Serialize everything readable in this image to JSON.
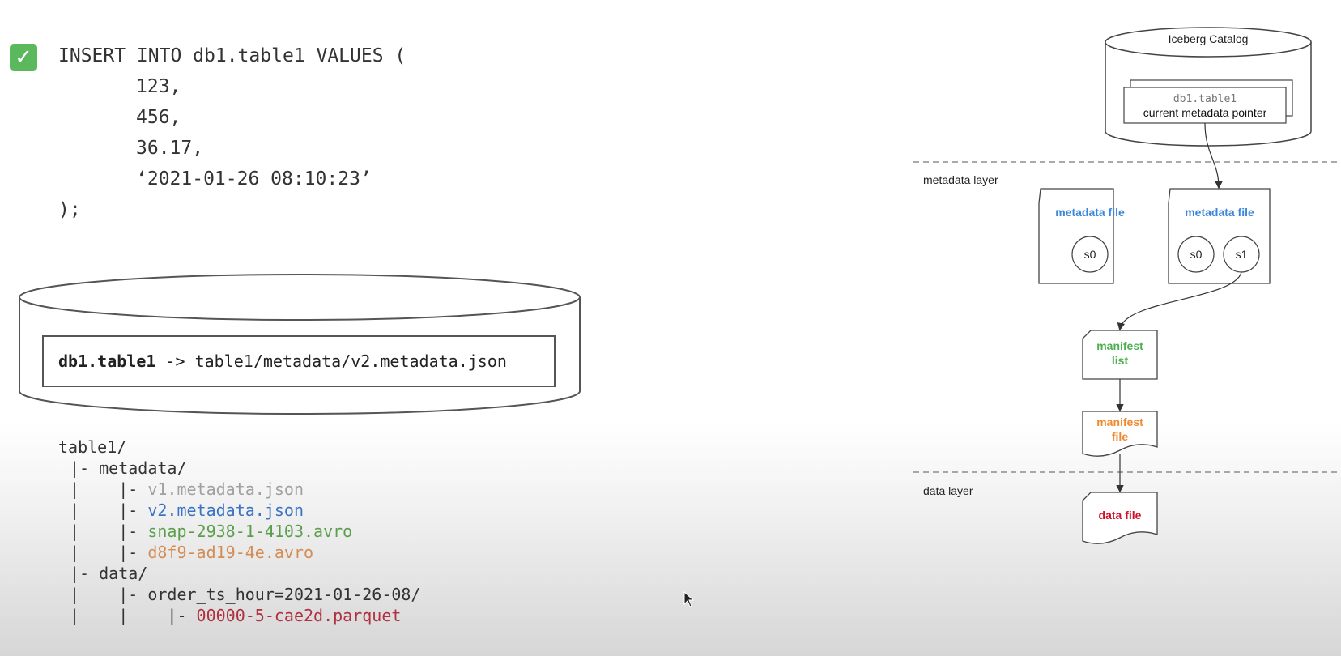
{
  "sql": {
    "lines": [
      "INSERT INTO db1.table1 VALUES (",
      "123,",
      "456,",
      "36.17,",
      "‘2021-01-26 08:10:23’",
      ");"
    ]
  },
  "catalog_box": {
    "table_name": "db1.table1",
    "pointer": " -> table1/metadata/v2.metadata.json"
  },
  "tree": {
    "root": "table1/",
    "metadata_dir": "|- metadata/",
    "prefix_file": "|    |- ",
    "v1": "v1.metadata.json",
    "v2": "v2.metadata.json",
    "snap": "snap-2938-1-4103.avro",
    "manifest": "d8f9-ad19-4e.avro",
    "data_dir": "|- data/",
    "partition_line": "|    |- order_ts_hour=2021-01-26-08/",
    "prefix_data_file": "|    |    |- ",
    "parquet": "00000-5-cae2d.parquet"
  },
  "diagram": {
    "catalog_title": "Iceberg Catalog",
    "catalog_table": "db1.table1",
    "catalog_pointer": "current metadata pointer",
    "metadata_layer": "metadata layer",
    "data_layer": "data layer",
    "metadata_file_1": "metadata file",
    "metadata_file_2": "metadata file",
    "snapshot_s0_a": "s0",
    "snapshot_s0_b": "s0",
    "snapshot_s1": "s1",
    "manifest_list_line1": "manifest",
    "manifest_list_line2": "list",
    "manifest_file_line1": "manifest",
    "manifest_file_line2": "file",
    "data_file": "data file"
  },
  "colors": {
    "check": "#5cb85c",
    "metadata_blue": "#3a86d8",
    "manifest_list_green": "#4caf50",
    "manifest_file_orange": "#f08a30",
    "data_file_red": "#d0102a"
  },
  "icons": [
    "check-icon",
    "cursor-icon"
  ]
}
